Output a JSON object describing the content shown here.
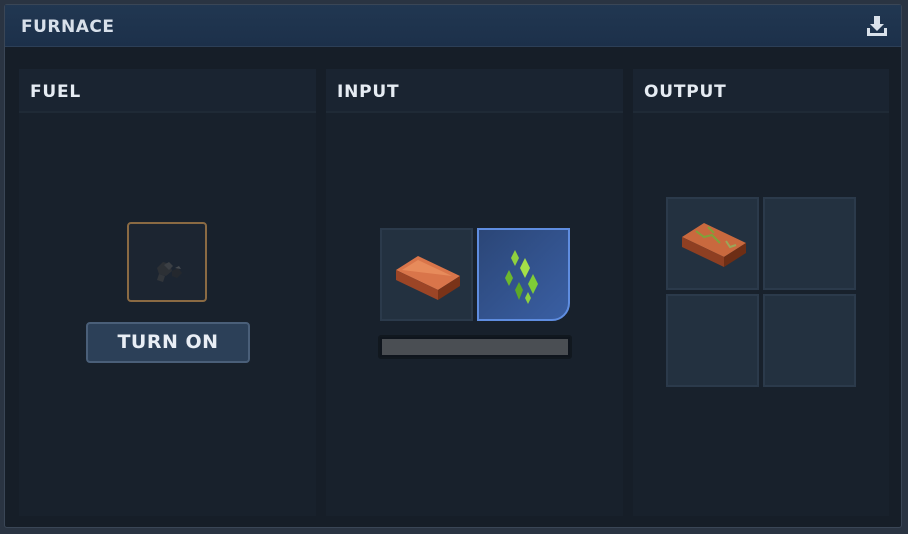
{
  "window": {
    "title": "FURNACE",
    "action_icon": "download-icon"
  },
  "fuel": {
    "heading": "FUEL",
    "slot": {
      "item": "coal",
      "icon": "coal-icon"
    },
    "button_label": "TURN ON"
  },
  "input": {
    "heading": "INPUT",
    "slots": [
      {
        "item": "copper ingot",
        "icon": "copper-ingot-icon",
        "selected": false
      },
      {
        "item": "green crystals",
        "icon": "green-crystal-icon",
        "selected": true
      }
    ],
    "progress": 1.0
  },
  "output": {
    "heading": "OUTPUT",
    "slots": [
      {
        "item": "cracked copper brick",
        "icon": "copper-brick-icon"
      },
      {
        "item": "",
        "icon": ""
      },
      {
        "item": "",
        "icon": ""
      },
      {
        "item": "",
        "icon": ""
      }
    ]
  },
  "colors": {
    "accent": "#5f8de0",
    "fuel_slot_border": "#8a6a43",
    "title_bar": "#1e3350"
  }
}
